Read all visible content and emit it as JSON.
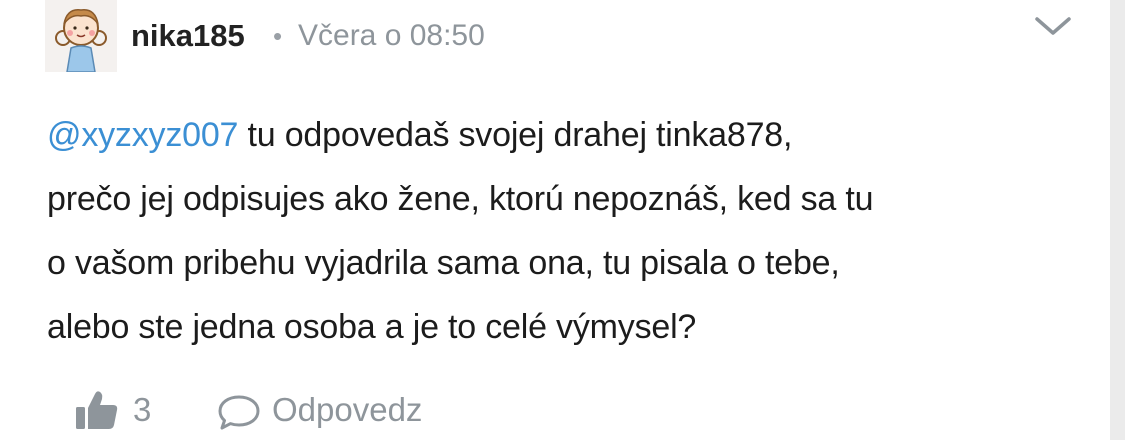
{
  "comment": {
    "author": "nika185",
    "separator": "•",
    "timestamp": "Včera o 08:50",
    "avatar_icon": "girl-avatar-icon",
    "menu_icon": "chevron-down-icon",
    "mention": "@xyzxyz007",
    "text_lines": [
      " tu odpovedaš svojej drahej tinka878,",
      "prečo jej odpisujes ako žene, ktorú nepoznáš, ked sa tu",
      "o vašom pribehu vyjadrila sama ona, tu pisala o tebe,",
      "alebo ste jedna osoba a je to celé výmysel?"
    ]
  },
  "actions": {
    "like_icon": "thumbs-up-icon",
    "like_count": "3",
    "reply_icon": "speech-bubble-icon",
    "reply_label": "Odpovedz"
  },
  "colors": {
    "mention": "#3b8fd4",
    "muted": "#8e959b",
    "text": "#1c1c1c",
    "background": "#ebebeb",
    "card": "#ffffff"
  }
}
